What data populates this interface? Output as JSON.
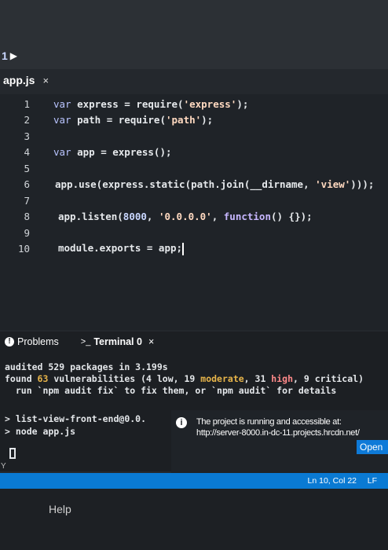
{
  "run": {
    "number": "1",
    "play_glyph": "▶"
  },
  "editor_tab": {
    "filename": "app.js",
    "close_glyph": "×"
  },
  "code_lines": [
    {
      "n": "1",
      "html": "<span class=\"kw\">var</span> express = require(<span class=\"str\">'express'</span>);"
    },
    {
      "n": "2",
      "html": "<span class=\"kw\">var</span> path = require(<span class=\"str\">'path'</span>);"
    },
    {
      "n": "3",
      "html": ""
    },
    {
      "n": "4",
      "html": "<span class=\"kw\">var</span> app = express();"
    },
    {
      "n": "5",
      "html": ""
    },
    {
      "n": "6",
      "html": "app.use(express.static(path.join(__dirname, <span class=\"str\">'view'</span>)));"
    },
    {
      "n": "7",
      "html": ""
    },
    {
      "n": "8",
      "html": "app.listen(<span class=\"num\">8000</span>, <span class=\"str\">'0.0.0.0'</span>, <span class=\"fn\">function</span>() {});"
    },
    {
      "n": "9",
      "html": ""
    },
    {
      "n": "10",
      "html": "module.exports = app;"
    }
  ],
  "panel": {
    "problems_label": "Problems",
    "problems_icon": "!",
    "terminal_label": "Terminal 0",
    "terminal_icon": ">_",
    "close_glyph": "×"
  },
  "terminal": {
    "line1": "audited 529 packages in 3.199s",
    "line2_prefix": "found ",
    "line2_count": "63",
    "line2_mid": " vulnerabilities (4 low, 19 ",
    "line2_moderate": "moderate",
    "line2_sep": ", 31 ",
    "line2_high": "high",
    "line2_tail": ", 9 critical)",
    "line3": "  run `npm audit fix` to fix them, or `npm audit` for details",
    "prompt1": "> list-view-front-end@0.0.",
    "prompt2": "> node app.js"
  },
  "toast": {
    "icon": "i",
    "message": "The project is running and accessible at: http://server-8000.in-dc-11.projects.hrcdn.net/",
    "button_label": "Open"
  },
  "statusbar": {
    "position": "Ln 10, Col 22",
    "eol": "LF"
  },
  "bottom": {
    "help_label": "Help"
  },
  "corner_glyph": "Y"
}
